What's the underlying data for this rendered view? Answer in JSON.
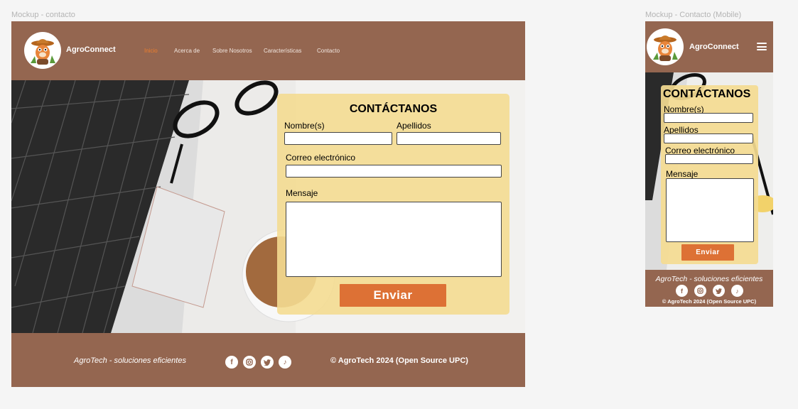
{
  "frames": {
    "desktop_label": "Mockup - contacto",
    "mobile_label": "Mockup - Contacto (Mobile)"
  },
  "brand": {
    "name": "AgroConnect",
    "logo_icon": "farmer-mascot-logo-icon"
  },
  "nav": {
    "items": [
      "Inicio",
      "Acerca de",
      "Sobre Nosotros",
      "Características",
      "Contacto"
    ],
    "active_index": 0
  },
  "form": {
    "title": "CONTÁCTANOS",
    "first_name_label": "Nombre(s)",
    "last_name_label": "Apellidos",
    "email_label": "Correo electrónico",
    "message_label": "Mensaje",
    "submit_label": "Enviar"
  },
  "footer": {
    "tagline": "AgroTech - soluciones eficientes",
    "copyright": "© AgroTech 2024 (Open Source UPC)",
    "social_icons": [
      "facebook-icon",
      "instagram-icon",
      "twitter-icon",
      "tiktok-icon"
    ]
  },
  "colors": {
    "brown": "#946650",
    "card": "#f4db91",
    "button": "#dd7135",
    "nav_active": "#ee7e2d",
    "page_bg": "#f5f5f5"
  },
  "hero_image": "laptop-glasses-coffee-photo"
}
